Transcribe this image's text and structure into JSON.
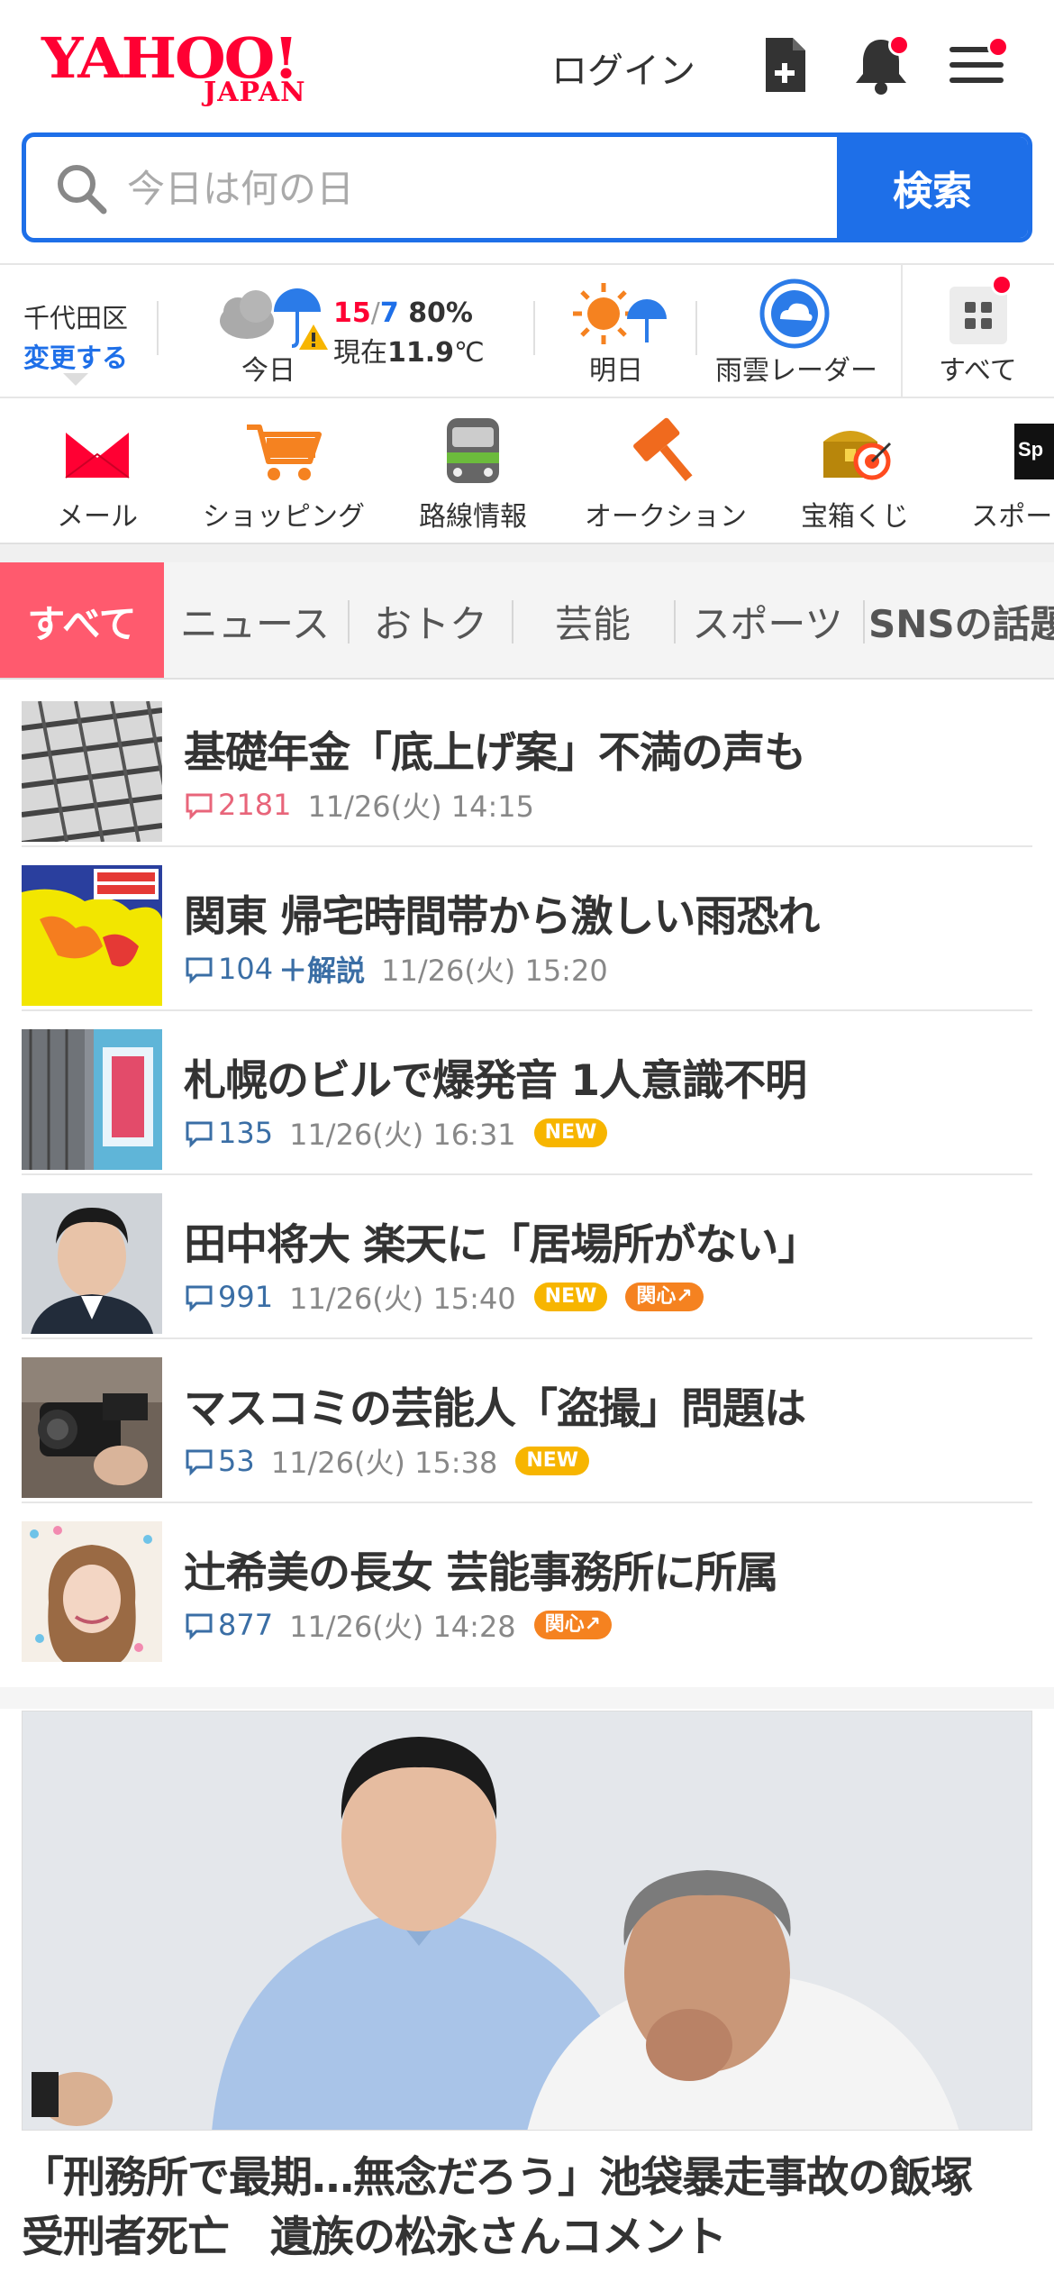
{
  "header": {
    "logo_main": "YAHOO!",
    "logo_sub": "JAPAN",
    "login_label": "ログイン",
    "icons": [
      "note-add-icon",
      "bell-icon",
      "menu-icon"
    ]
  },
  "search": {
    "placeholder": "今日は何の日",
    "button_label": "検索"
  },
  "weather": {
    "area_name": "千代田区",
    "area_change": "変更する",
    "today_label": "今日",
    "temp_high": "15",
    "temp_low": "7",
    "precip": "80%",
    "now_prefix": "現在",
    "now_temp": "11.9",
    "now_unit": "℃",
    "tomorrow_label": "明日",
    "radar_label": "雨雲レーダー",
    "all_label": "すべて",
    "colors": {
      "high": "#ff0033",
      "low": "#1e6fe8"
    }
  },
  "services": [
    {
      "label": "メール",
      "icon": "mail-icon"
    },
    {
      "label": "ショッピング",
      "icon": "cart-icon"
    },
    {
      "label": "路線情報",
      "icon": "train-icon"
    },
    {
      "label": "オークション",
      "icon": "gavel-icon"
    },
    {
      "label": "宝箱くじ",
      "icon": "treasure-icon"
    },
    {
      "label": "スポーツ",
      "icon": "sports-icon"
    }
  ],
  "tabs": [
    {
      "label": "すべて",
      "active": true
    },
    {
      "label": "ニュース"
    },
    {
      "label": "おトク"
    },
    {
      "label": "芸能"
    },
    {
      "label": "スポーツ"
    },
    {
      "label": "SNSの話題"
    }
  ],
  "news": [
    {
      "title": "基礎年金「底上げ案」不満の声も",
      "comments": "2181",
      "comment_color": "red",
      "time": "11/26(火) 14:15",
      "badges": []
    },
    {
      "title": "関東 帰宅時間帯から激しい雨恐れ",
      "comments": "104",
      "comment_color": "blue",
      "extra": "＋解説",
      "time": "11/26(火) 15:20",
      "badges": []
    },
    {
      "title": "札幌のビルで爆発音 1人意識不明",
      "comments": "135",
      "comment_color": "blue",
      "time": "11/26(火) 16:31",
      "badges": [
        "NEW"
      ]
    },
    {
      "title": "田中将大 楽天に「居場所がない」",
      "comments": "991",
      "comment_color": "blue",
      "time": "11/26(火) 15:40",
      "badges": [
        "NEW",
        "関心↗"
      ]
    },
    {
      "title": "マスコミの芸能人「盗撮」問題は",
      "comments": "53",
      "comment_color": "blue",
      "time": "11/26(火) 15:38",
      "badges": [
        "NEW"
      ]
    },
    {
      "title": "辻希美の長女 芸能事務所に所属",
      "comments": "877",
      "comment_color": "blue",
      "time": "11/26(火) 14:28",
      "badges": [
        "関心↗"
      ]
    }
  ],
  "feature": {
    "title_line1": "「刑務所で最期…無念だろう」池袋暴走事故の飯塚",
    "title_line2": "受刑者死亡　遺族の松永さんコメント"
  },
  "colors": {
    "brand_red": "#ff0033",
    "search_blue": "#1e6fe8",
    "tab_active": "#ff5a6e",
    "badge_new": "#f7b500",
    "badge_kanshin": "#f58220"
  }
}
